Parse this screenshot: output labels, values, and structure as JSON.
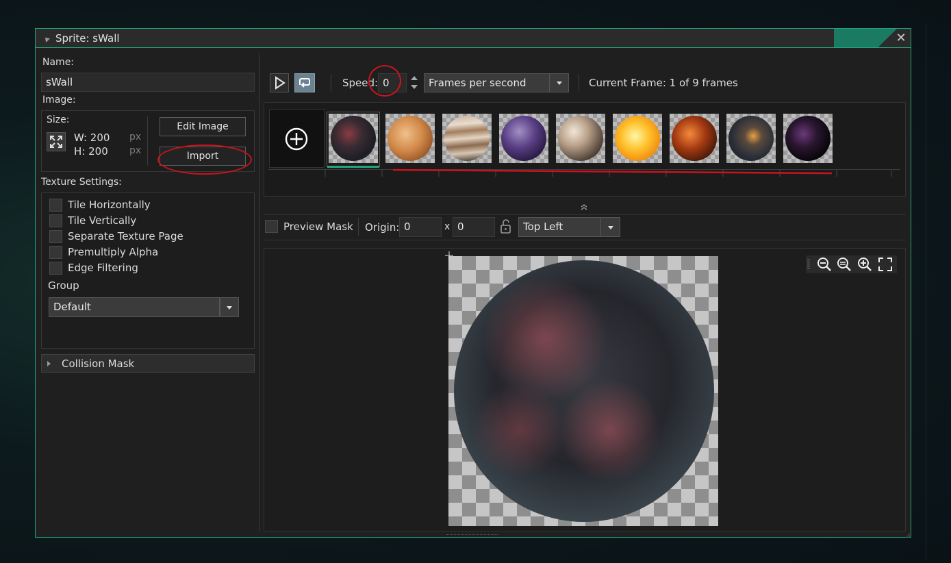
{
  "window": {
    "title": "Sprite: sWall",
    "close": "✕"
  },
  "left": {
    "name_label": "Name:",
    "name_value": "sWall",
    "image_label": "Image:",
    "size_label": "Size:",
    "width": "W: 200",
    "height": "H: 200",
    "unit": "px",
    "edit_image": "Edit Image",
    "import": "Import",
    "texture_label": "Texture Settings:",
    "texture_options": [
      "Tile Horizontally",
      "Tile Vertically",
      "Separate Texture Page",
      "Premultiply Alpha",
      "Edge Filtering"
    ],
    "group_label": "Group",
    "group_value": "Default",
    "collision_mask": "Collision Mask"
  },
  "toolbar": {
    "speed_label": "Speed:",
    "speed_value": "0",
    "speed_unit": "Frames per second",
    "current_frame": "Current Frame: 1 of 9 frames"
  },
  "frames": {
    "add_icon": "plus-circle-icon",
    "count": 9,
    "selected_index": 0
  },
  "mask_bar": {
    "preview_mask": "Preview Mask",
    "origin_label": "Origin:",
    "origin_x": "0",
    "x_sep": "x",
    "origin_y": "0",
    "origin_preset": "Top Left"
  },
  "colors": {
    "accent": "#23a37f",
    "annotation": "#c8141e",
    "panel": "#1f1f1f"
  }
}
